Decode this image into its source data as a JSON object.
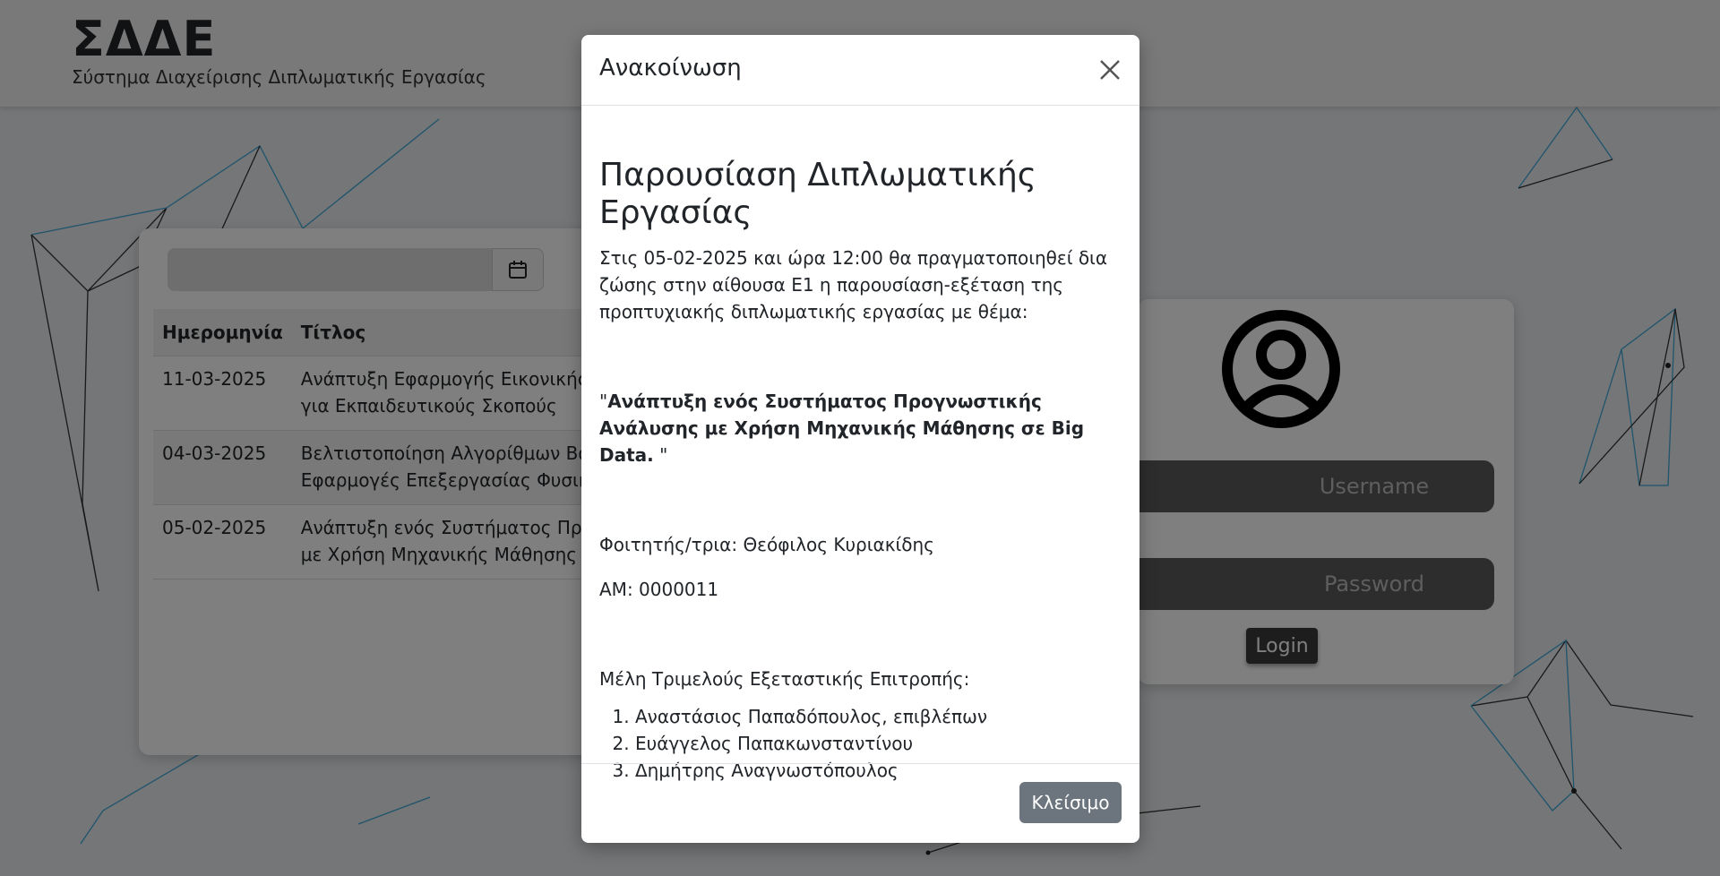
{
  "header": {
    "brand": "ΣΔΔΕ",
    "subtitle": "Σύστημα Διαχείρισης Διπλωματικής Εργασίας"
  },
  "announcements": {
    "columns": [
      "Ημερομηνία",
      "Τίτλος"
    ],
    "rows": [
      {
        "date": "11-03-2025",
        "title_line1": "Ανάπτυξη Εφαρμογής Εικονικής Πρ",
        "title_line2": "για Εκπαιδευτικούς Σκοπούς"
      },
      {
        "date": "04-03-2025",
        "title_line1": "Βελτιστοποίηση Αλγορίθμων Βαθιά",
        "title_line2": "Εφαρμογές Επεξεργασίας Φυσικής"
      },
      {
        "date": "05-02-2025",
        "title_line1": "Ανάπτυξη ενός Συστήματος Προγνω",
        "title_line2": "με Χρήση Μηχανικής Μάθησης σε Ε"
      }
    ],
    "calendar_icon": "calendar-icon"
  },
  "login": {
    "username_placeholder": "Username",
    "password_placeholder": "Password",
    "login_label": "Login",
    "avatar_icon": "user-circle-icon"
  },
  "modal": {
    "title": "Ανακοίνωση",
    "close_icon": "close-icon",
    "heading": "Παρουσίαση Διπλωματικής Εργασίας",
    "intro": "Στις 05-02-2025 και ώρα 12:00 θα πραγματοποιηθεί δια ζώσης στην αίθουσα Ε1 η παρουσίαση-εξέταση της προπτυχιακής διπλωματικής εργασίας με θέμα:",
    "thesis_open_quote": "\"",
    "thesis_title": "Ανάπτυξη ενός Συστήματος Προγνωστικής Ανάλυσης με Χρήση Μηχανικής Μάθησης σε Big Data.",
    "thesis_close_quote": " \"",
    "student": "Φοιτητής/τρια: Θεόφιλος Κυριακίδης",
    "am": "ΑΜ: 0000011",
    "committee_label": "Μέλη Τριμελούς Εξεταστικής Επιτροπής:",
    "committee": [
      "Αναστάσιος Παπαδόπουλος, επιβλέπων",
      "Ευάγγελος Παπακωνσταντίνου",
      "Δημήτρης Αναγνωστόπουλος"
    ],
    "close_button": "Κλείσιμο"
  },
  "colors": {
    "backdrop": "rgba(0,0,0,0.5)",
    "close_button_bg": "#6c757d",
    "login_input_bg": "#5a5a5a",
    "network_line_dark": "#333333",
    "network_line_blue": "#3fa9d8"
  }
}
